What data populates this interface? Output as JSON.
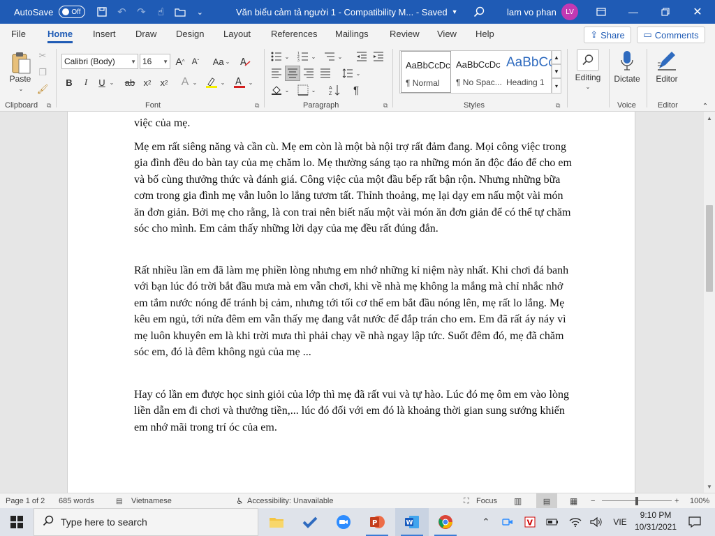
{
  "titlebar": {
    "autosave_label": "AutoSave",
    "autosave_state": "Off",
    "document_title": "Văn biểu cảm tả người 1  -  Compatibility M...  -  Saved",
    "user_name": "lam vo phan",
    "user_initials": "LV"
  },
  "tabs": [
    {
      "label": "File"
    },
    {
      "label": "Home"
    },
    {
      "label": "Insert"
    },
    {
      "label": "Draw"
    },
    {
      "label": "Design"
    },
    {
      "label": "Layout"
    },
    {
      "label": "References"
    },
    {
      "label": "Mailings"
    },
    {
      "label": "Review"
    },
    {
      "label": "View"
    },
    {
      "label": "Help"
    }
  ],
  "share_label": "Share",
  "comments_label": "Comments",
  "ribbon": {
    "clipboard": {
      "label": "Clipboard",
      "paste_label": "Paste"
    },
    "font": {
      "label": "Font",
      "font_name": "Calibri (Body)",
      "font_size": "16",
      "case_label": "Aa"
    },
    "paragraph": {
      "label": "Paragraph"
    },
    "styles": {
      "label": "Styles",
      "items": [
        {
          "preview": "AaBbCcDc",
          "name": "¶ Normal"
        },
        {
          "preview": "AaBbCcDc",
          "name": "¶ No Spac..."
        },
        {
          "preview": "AaBbCc",
          "name": "Heading 1"
        }
      ]
    },
    "editing_label": "Editing",
    "voice": {
      "label": "Voice",
      "dictate_label": "Dictate"
    },
    "editor": {
      "label": "Editor",
      "editor_label": "Editor"
    }
  },
  "document": {
    "paragraphs": [
      "việc của mẹ.",
      "Mẹ em rất siêng năng và cần cù. Mẹ em còn là một bà nội trợ rất đảm đang. Mọi công việc trong gia đình đều do bàn tay của mẹ chăm lo. Mẹ thường sáng tạo ra những món ăn độc đáo để cho em và bố cùng thưởng thức và đánh giá. Công việc của một đầu bếp rất bận rộn. Nhưng những bữa cơm trong gia đình mẹ vẫn luôn lo lắng tươm tất. Thỉnh thoảng, mẹ lại dạy em nấu một vài món ăn đơn giản. Bởi mẹ cho rằng, là con trai nên biết nấu một vài món ăn đơn giản để có thể tự chăm sóc cho mình. Em cảm thấy những lời dạy của mẹ đều rất đúng đắn.",
      "Rất nhiều lần em đã làm mẹ phiền lòng nhưng em nhớ những kỉ niệm này nhất. Khi chơi đá banh với bạn lúc đó trời bắt đầu mưa mà em vẫn chơi, khi về nhà mẹ không la mắng mà chỉ nhắc nhở em tắm nước nóng để tránh bị cảm, nhưng tới tối cơ thể em bắt đầu nóng lên, mẹ rất lo lắng. Mẹ kêu em ngủ, tới nửa đêm em vẫn thấy mẹ đang vắt nước để đắp trán cho em. Em đã rất áy náy vì mẹ luôn khuyên em là khi trời mưa thì phải chạy về nhà ngay lập tức. Suốt đêm đó, mẹ đã chăm sóc em, đó là đêm không ngủ của mẹ ...",
      "Hay có lần em được học sinh giỏi của lớp thì mẹ đã rất vui và tự hào. Lúc đó mẹ ôm em vào lòng liền dẫn em đi chơi và thưởng tiền,... lúc đó đối với em đó là khoảng thời gian sung sướng khiến em nhớ mãi trong trí óc của em."
    ]
  },
  "statusbar": {
    "page": "Page 1 of 2",
    "words": "685 words",
    "language": "Vietnamese",
    "accessibility": "Accessibility: Unavailable",
    "focus": "Focus",
    "zoom": "100%"
  },
  "taskbar": {
    "search_placeholder": "Type here to search",
    "language": "VIE",
    "time": "9:10 PM",
    "date": "10/31/2021"
  },
  "colors": {
    "titlebar": "#1f5bb5",
    "accent": "#1f5bb5",
    "avatar": "#c239b3"
  }
}
